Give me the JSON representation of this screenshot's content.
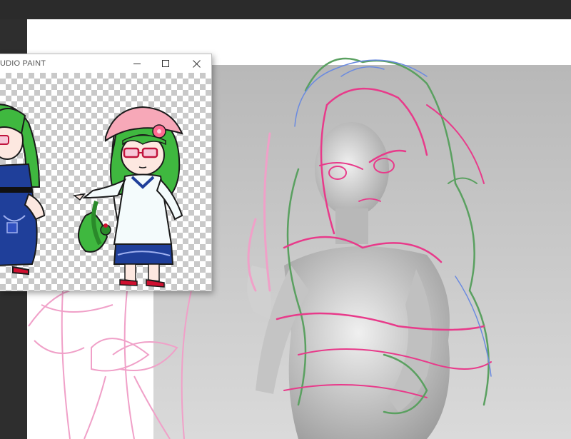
{
  "app": {
    "window_title": "UDIO PAINT"
  },
  "sub_window": {
    "controls": {
      "minimize_icon": "minimize-icon",
      "maximize_icon": "maximize-icon",
      "close_icon": "close-icon"
    }
  },
  "canvas": {
    "sketch_colors": {
      "pink": "#e83a8a",
      "light_pink": "#f0a0c8",
      "green": "#5aa060",
      "blue": "#8090e0"
    }
  }
}
